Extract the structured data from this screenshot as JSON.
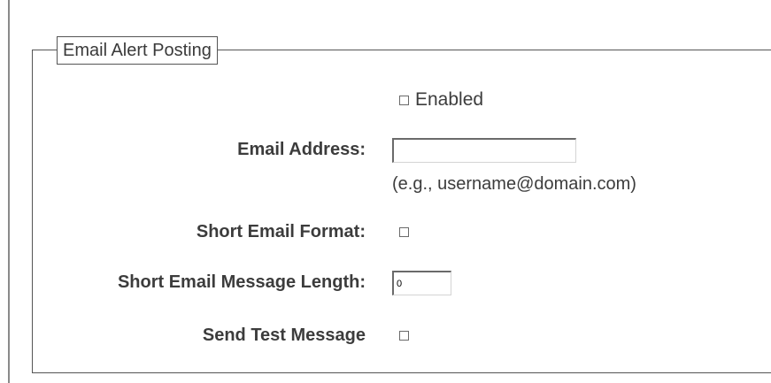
{
  "section": {
    "legend": "Email Alert Posting"
  },
  "form": {
    "enabled_label": "Enabled",
    "enabled_checked": false,
    "email_address_label": "Email Address:",
    "email_address_value": "",
    "email_address_hint": "(e.g., username@domain.com)",
    "short_format_label": "Short Email Format:",
    "short_format_checked": false,
    "message_length_label": "Short Email Message Length:",
    "message_length_value": "0",
    "send_test_label": "Send Test Message",
    "send_test_checked": false
  }
}
